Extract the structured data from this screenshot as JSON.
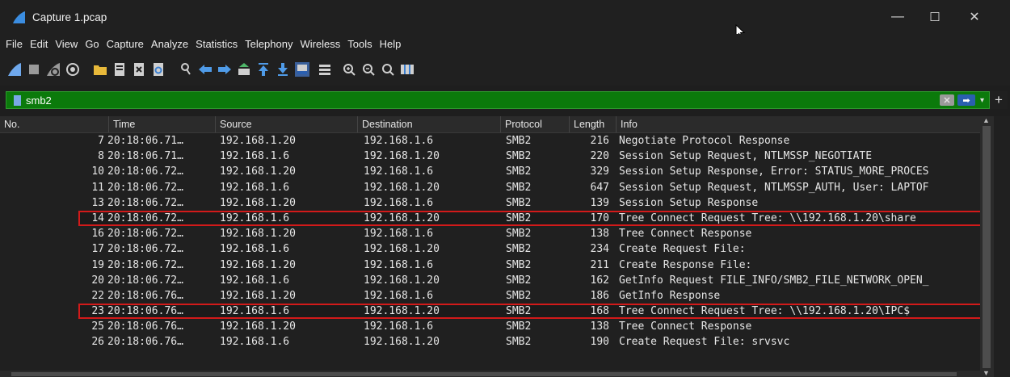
{
  "window": {
    "title": "Capture 1.pcap",
    "minimize_label": "—",
    "maximize_label": "☐",
    "close_label": "✕"
  },
  "menu": [
    "File",
    "Edit",
    "View",
    "Go",
    "Capture",
    "Analyze",
    "Statistics",
    "Telephony",
    "Wireless",
    "Tools",
    "Help"
  ],
  "toolbar_icons": [
    "start-capture-icon",
    "stop-capture-icon",
    "restart-capture-icon",
    "capture-options-icon",
    "open-file-icon",
    "save-file-icon",
    "close-file-icon",
    "reload-file-icon",
    "find-packet-icon",
    "go-back-icon",
    "go-forward-icon",
    "go-to-packet-icon",
    "go-first-icon",
    "go-last-icon",
    "autoscroll-icon",
    "colorize-icon",
    "zoom-in-icon",
    "zoom-out-icon",
    "zoom-reset-icon",
    "resize-columns-icon"
  ],
  "filter": {
    "value": "smb2",
    "accent": "#0b7a0b"
  },
  "columns": [
    "No.",
    "Time",
    "Source",
    "Destination",
    "Protocol",
    "Length",
    "Info"
  ],
  "rows": [
    {
      "no": "7",
      "time": "20:18:06.71…",
      "src": "192.168.1.20",
      "dst": "192.168.1.6",
      "proto": "SMB2",
      "len": "216",
      "info": "Negotiate Protocol Response"
    },
    {
      "no": "8",
      "time": "20:18:06.71…",
      "src": "192.168.1.6",
      "dst": "192.168.1.20",
      "proto": "SMB2",
      "len": "220",
      "info": "Session Setup Request, NTLMSSP_NEGOTIATE"
    },
    {
      "no": "10",
      "time": "20:18:06.72…",
      "src": "192.168.1.20",
      "dst": "192.168.1.6",
      "proto": "SMB2",
      "len": "329",
      "info": "Session Setup Response, Error: STATUS_MORE_PROCES"
    },
    {
      "no": "11",
      "time": "20:18:06.72…",
      "src": "192.168.1.6",
      "dst": "192.168.1.20",
      "proto": "SMB2",
      "len": "647",
      "info": "Session Setup Request, NTLMSSP_AUTH, User: LAPTOF"
    },
    {
      "no": "13",
      "time": "20:18:06.72…",
      "src": "192.168.1.20",
      "dst": "192.168.1.6",
      "proto": "SMB2",
      "len": "139",
      "info": "Session Setup Response"
    },
    {
      "no": "14",
      "time": "20:18:06.72…",
      "src": "192.168.1.6",
      "dst": "192.168.1.20",
      "proto": "SMB2",
      "len": "170",
      "info": "Tree Connect Request Tree: \\\\192.168.1.20\\share",
      "highlight": true
    },
    {
      "no": "16",
      "time": "20:18:06.72…",
      "src": "192.168.1.20",
      "dst": "192.168.1.6",
      "proto": "SMB2",
      "len": "138",
      "info": "Tree Connect Response"
    },
    {
      "no": "17",
      "time": "20:18:06.72…",
      "src": "192.168.1.6",
      "dst": "192.168.1.20",
      "proto": "SMB2",
      "len": "234",
      "info": "Create Request File:"
    },
    {
      "no": "19",
      "time": "20:18:06.72…",
      "src": "192.168.1.20",
      "dst": "192.168.1.6",
      "proto": "SMB2",
      "len": "211",
      "info": "Create Response File:"
    },
    {
      "no": "20",
      "time": "20:18:06.72…",
      "src": "192.168.1.6",
      "dst": "192.168.1.20",
      "proto": "SMB2",
      "len": "162",
      "info": "GetInfo Request FILE_INFO/SMB2_FILE_NETWORK_OPEN_"
    },
    {
      "no": "22",
      "time": "20:18:06.76…",
      "src": "192.168.1.20",
      "dst": "192.168.1.6",
      "proto": "SMB2",
      "len": "186",
      "info": "GetInfo Response"
    },
    {
      "no": "23",
      "time": "20:18:06.76…",
      "src": "192.168.1.6",
      "dst": "192.168.1.20",
      "proto": "SMB2",
      "len": "168",
      "info": "Tree Connect Request Tree: \\\\192.168.1.20\\IPC$",
      "highlight": true
    },
    {
      "no": "25",
      "time": "20:18:06.76…",
      "src": "192.168.1.20",
      "dst": "192.168.1.6",
      "proto": "SMB2",
      "len": "138",
      "info": "Tree Connect Response"
    },
    {
      "no": "26",
      "time": "20:18:06.76…",
      "src": "192.168.1.6",
      "dst": "192.168.1.20",
      "proto": "SMB2",
      "len": "190",
      "info": "Create Request File: srvsvc"
    }
  ],
  "colors": {
    "highlight_border": "#d21a1a",
    "window_bg": "#202020"
  }
}
